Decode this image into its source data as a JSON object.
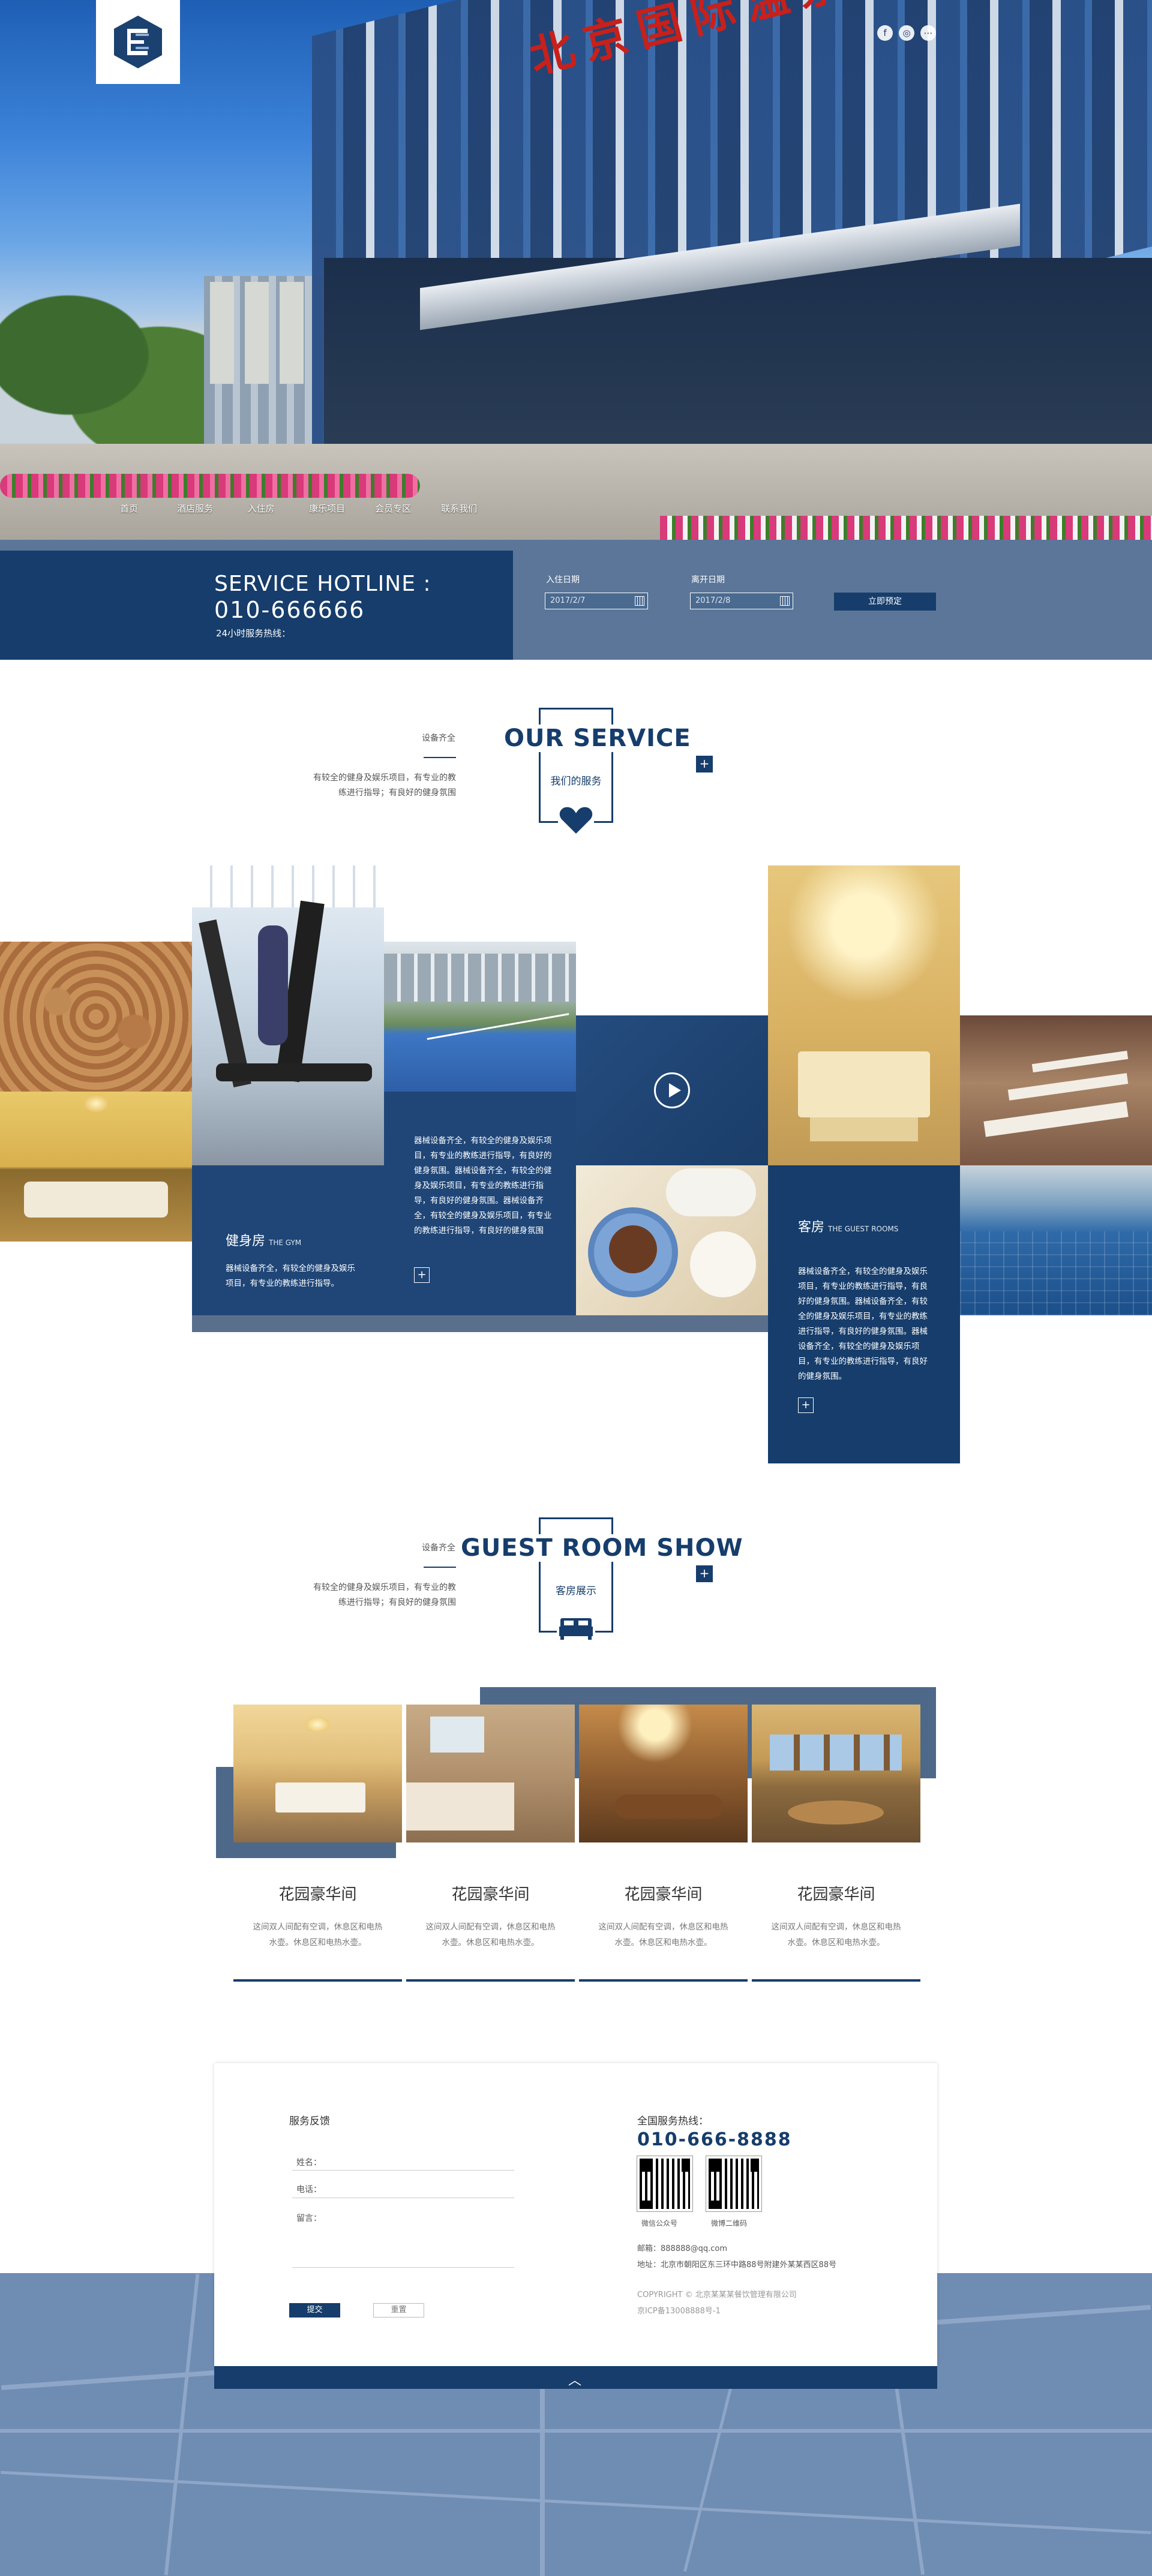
{
  "nav": {
    "items": [
      "首页",
      "酒店服务",
      "入住房",
      "康乐项目",
      "会员专区",
      "联系我们"
    ]
  },
  "hero": {
    "sign_text": "北京国际温泉体育健身"
  },
  "social": {
    "icons": [
      "f",
      "◎",
      "⋯"
    ]
  },
  "hotline": {
    "label": "SERVICE HOTLINE :",
    "number": "010-666666",
    "sub": "24小时服务热线："
  },
  "booking": {
    "checkin_label": "入住日期",
    "checkin_value": "2017/2/7",
    "checkout_label": "离开日期",
    "checkout_value": "2017/2/8",
    "button": "立即预定"
  },
  "service_section": {
    "sub": "设备齐全",
    "desc_line1": "有较全的健身及娱乐项目，有专业的教",
    "desc_line2": "练进行指导；有良好的健身氛围",
    "title": "OUR SERVICE",
    "title_cn": "我们的服务",
    "plus": "+"
  },
  "service_tiles": {
    "gym_title": "健身房",
    "gym_title_en": "THE GYM",
    "gym_text": "器械设备齐全，有较全的健身及娱乐项目，有专业的教练进行指导。",
    "mid_text": "器械设备齐全，有较全的健身及娱乐项目，有专业的教练进行指导，有良好的健身氛围。器械设备齐全，有较全的健身及娱乐项目，有专业的教练进行指导，有良好的健身氛围。器械设备齐全，有较全的健身及娱乐项目，有专业的教练进行指导，有良好的健身氛围",
    "room_title": "客房",
    "room_title_en": "THE GUEST ROOMS",
    "room_text": "器械设备齐全，有较全的健身及娱乐项目，有专业的教练进行指导，有良好的健身氛围。器械设备齐全，有较全的健身及娱乐项目，有专业的教练进行指导，有良好的健身氛围。器械设备齐全，有较全的健身及娱乐项目，有专业的教练进行指导，有良好的健身氛围。",
    "plus": "+"
  },
  "rooms_section": {
    "sub": "设备齐全",
    "desc_line1": "有较全的健身及娱乐项目，有专业的教",
    "desc_line2": "练进行指导；有良好的健身氛围",
    "title": "GUEST ROOM SHOW",
    "title_cn": "客房展示",
    "plus": "+"
  },
  "rooms": [
    {
      "name": "花园豪华间",
      "desc1": "这间双人间配有空调，休息区和电热",
      "desc2": "水壶。休息区和电热水壶。"
    },
    {
      "name": "花园豪华间",
      "desc1": "这间双人间配有空调，休息区和电热",
      "desc2": "水壶。休息区和电热水壶。"
    },
    {
      "name": "花园豪华间",
      "desc1": "这间双人间配有空调，休息区和电热",
      "desc2": "水壶。休息区和电热水壶。"
    },
    {
      "name": "花园豪华间",
      "desc1": "这间双人间配有空调，休息区和电热",
      "desc2": "水壶。休息区和电热水壶。"
    }
  ],
  "feedback": {
    "title": "服务反馈",
    "name_label": "姓名：",
    "phone_label": "电话：",
    "message_label": "留言：",
    "submit": "提交",
    "reset": "重置"
  },
  "contact": {
    "hotline_label": "全国服务热线：",
    "hotline": "010-666-8888",
    "qr1_label": "微信公众号",
    "qr2_label": "微博二维码",
    "email": "邮箱：888888@qq.com",
    "address": "地址：北京市朝阳区东三环中路88号附建外某某西区88号",
    "copyright": "COPYRIGHT © 北京某某某餐饮管理有限公司",
    "icp": "京ICP备13008888号-1",
    "up_arrow": "︿"
  },
  "colors": {
    "primary": "#163d6b",
    "band": "#5b7698",
    "map": "#6f8cb3"
  }
}
